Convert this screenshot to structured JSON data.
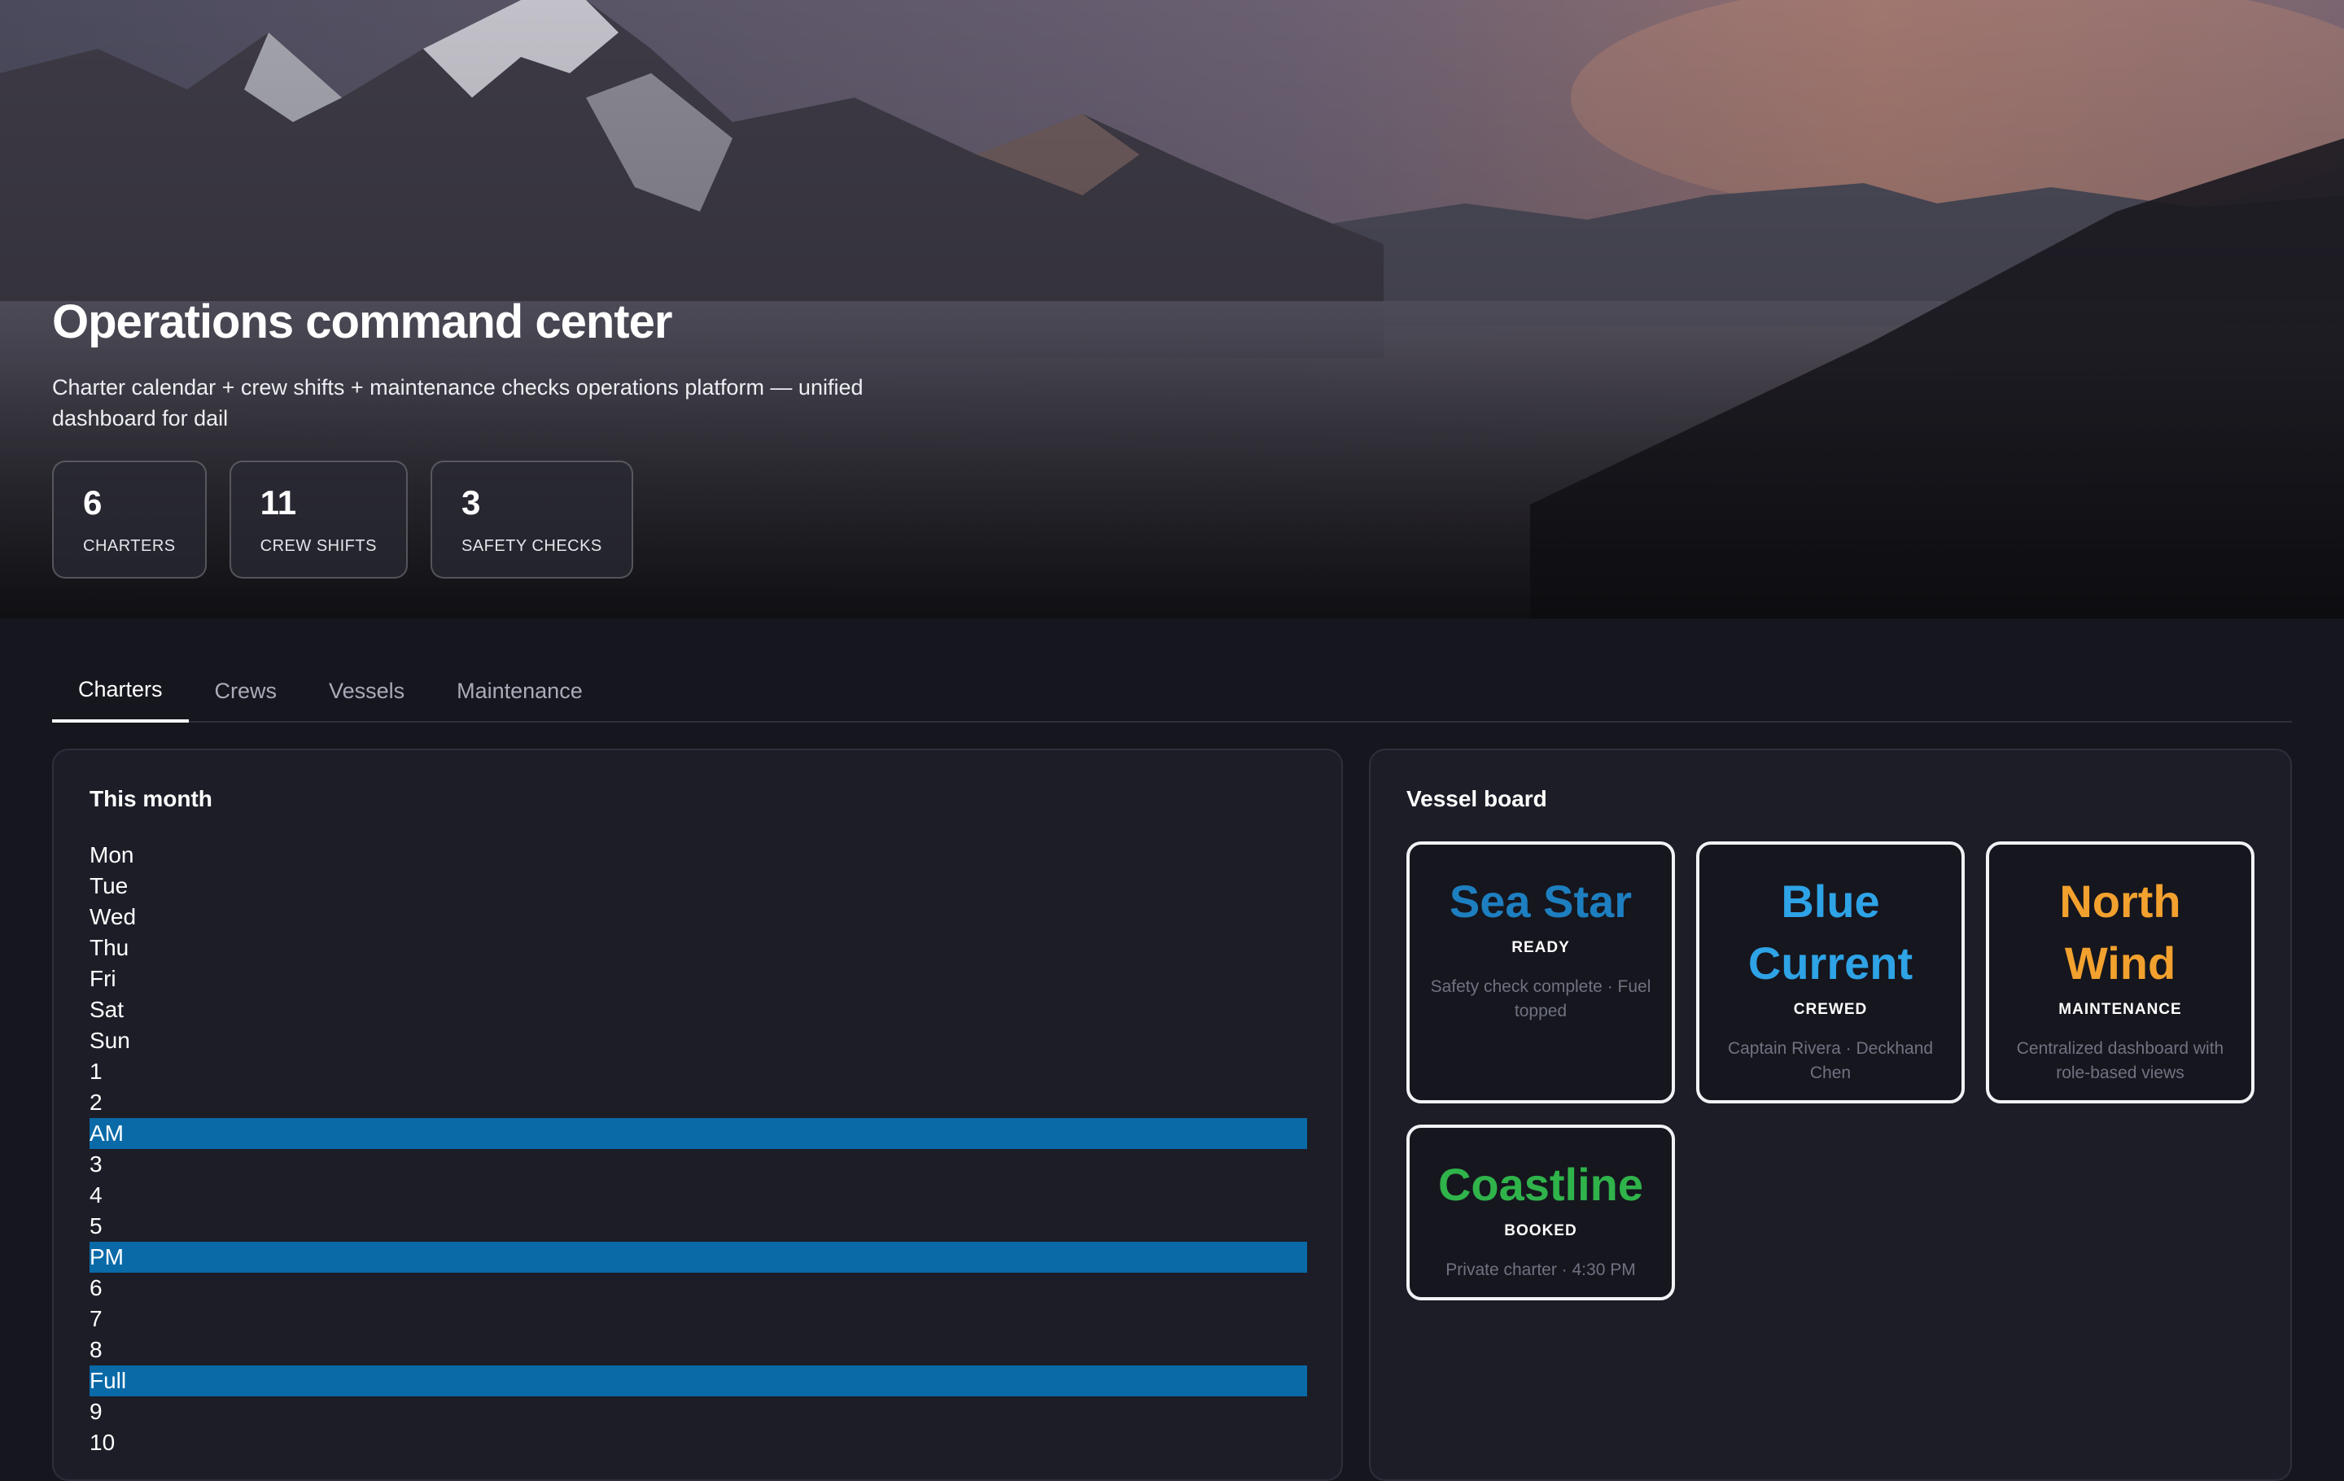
{
  "hero": {
    "title": "Operations command center",
    "subtitle": "Charter calendar + crew shifts + maintenance checks operations platform — unified dashboard for dail",
    "stats": [
      {
        "value": "6",
        "label": "CHARTERS"
      },
      {
        "value": "11",
        "label": "CREW SHIFTS"
      },
      {
        "value": "3",
        "label": "SAFETY CHECKS"
      }
    ]
  },
  "tabs": [
    {
      "label": "Charters",
      "active": true
    },
    {
      "label": "Crews",
      "active": false
    },
    {
      "label": "Vessels",
      "active": false
    },
    {
      "label": "Maintenance",
      "active": false
    }
  ],
  "calendar": {
    "title": "This month",
    "rows": [
      {
        "text": "Mon",
        "highlight": false
      },
      {
        "text": "Tue",
        "highlight": false
      },
      {
        "text": "Wed",
        "highlight": false
      },
      {
        "text": "Thu",
        "highlight": false
      },
      {
        "text": "Fri",
        "highlight": false
      },
      {
        "text": "Sat",
        "highlight": false
      },
      {
        "text": "Sun",
        "highlight": false
      },
      {
        "text": "1",
        "highlight": false
      },
      {
        "text": "2",
        "highlight": false
      },
      {
        "text": "AM",
        "highlight": true
      },
      {
        "text": "3",
        "highlight": false
      },
      {
        "text": "4",
        "highlight": false
      },
      {
        "text": "5",
        "highlight": false
      },
      {
        "text": "PM",
        "highlight": true
      },
      {
        "text": "6",
        "highlight": false
      },
      {
        "text": "7",
        "highlight": false
      },
      {
        "text": "8",
        "highlight": false
      },
      {
        "text": "Full",
        "highlight": true
      },
      {
        "text": "9",
        "highlight": false
      },
      {
        "text": "10",
        "highlight": false
      }
    ]
  },
  "vessel_board": {
    "title": "Vessel board",
    "vessels": [
      {
        "name": "Sea Star",
        "status": "READY",
        "note": "Safety check complete · Fuel topped",
        "color": "#1d7fc0"
      },
      {
        "name": "Blue Current",
        "status": "CREWED",
        "note": "Captain Rivera · Deckhand Chen",
        "color": "#2ea3e6"
      },
      {
        "name": "North Wind",
        "status": "MAINTENANCE",
        "note": "Centralized dashboard with role-based views",
        "color": "#f2a12e"
      },
      {
        "name": "Coastline",
        "status": "BOOKED",
        "note": "Private charter · 4:30 PM",
        "color": "#2fb34a"
      }
    ]
  }
}
